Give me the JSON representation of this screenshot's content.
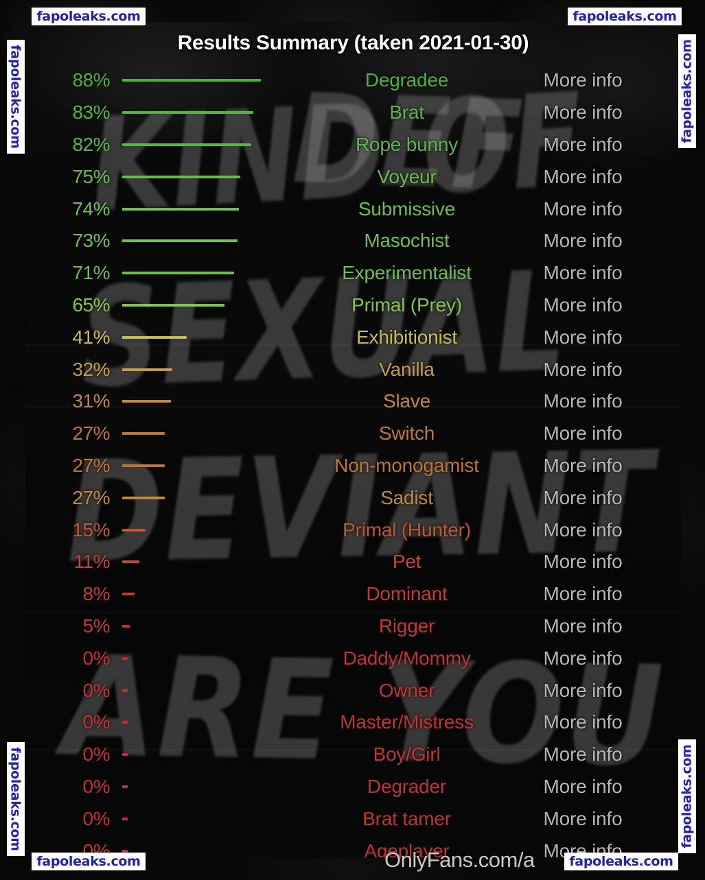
{
  "title": "Results Summary (taken 2021-01-30)",
  "handle": "OnlyFans.com/a",
  "more_info_label": "More info",
  "watermark": {
    "text": "fapoleaks.com",
    "color": "#2222aa"
  },
  "graffiti": [
    "KIND OF",
    "DEF",
    "SEXUAL",
    "DEVIANT",
    "ARE YOU"
  ],
  "colors": {
    "green": "#5bbf4b",
    "yellow": "#c9b23d",
    "orange": "#c2752f",
    "red": "#c73b32",
    "more_info": "#b5b5b5",
    "title": "#ffffff",
    "panel_bg": "#0a0a0a"
  },
  "chart_data": {
    "type": "bar",
    "title": "Results Summary (taken 2021-01-30)",
    "xlabel": "",
    "ylabel": "",
    "xlim": [
      0,
      100
    ],
    "grid": false,
    "legend": false,
    "orientation": "horizontal",
    "unit": "%",
    "categories": [
      "Degradee",
      "Brat",
      "Rope bunny",
      "Voyeur",
      "Submissive",
      "Masochist",
      "Experimentalist",
      "Primal (Prey)",
      "Exhibitionist",
      "Vanilla",
      "Slave",
      "Switch",
      "Non-monogamist",
      "Sadist",
      "Primal (Hunter)",
      "Pet",
      "Dominant",
      "Rigger",
      "Daddy/Mommy",
      "Owner",
      "Master/Mistress",
      "Boy/Girl",
      "Degrader",
      "Brat tamer",
      "Ageplayer"
    ],
    "values": [
      88,
      83,
      82,
      75,
      74,
      73,
      71,
      65,
      41,
      32,
      31,
      27,
      27,
      27,
      15,
      11,
      8,
      5,
      0,
      0,
      0,
      0,
      0,
      0,
      0
    ]
  },
  "rows": [
    {
      "pct": "88%",
      "value": 88,
      "label": "Degradee",
      "color": "#4caf3f",
      "more": "More info"
    },
    {
      "pct": "83%",
      "value": 83,
      "label": "Brat",
      "color": "#55b445",
      "more": "More info"
    },
    {
      "pct": "82%",
      "value": 82,
      "label": "Rope bunny",
      "color": "#57b646",
      "more": "More info"
    },
    {
      "pct": "75%",
      "value": 75,
      "label": "Voyeur",
      "color": "#66bd4e",
      "more": "More info"
    },
    {
      "pct": "74%",
      "value": 74,
      "label": "Submissive",
      "color": "#6dbf52",
      "more": "More info"
    },
    {
      "pct": "73%",
      "value": 73,
      "label": "Masochist",
      "color": "#6fc053",
      "more": "More info"
    },
    {
      "pct": "71%",
      "value": 71,
      "label": "Experimentalist",
      "color": "#6dbf52",
      "more": "More info"
    },
    {
      "pct": "65%",
      "value": 65,
      "label": "Primal (Prey)",
      "color": "#80c748",
      "more": "More info"
    },
    {
      "pct": "41%",
      "value": 41,
      "label": "Exhibitionist",
      "color": "#c6bb4e",
      "more": "More info"
    },
    {
      "pct": "32%",
      "value": 32,
      "label": "Vanilla",
      "color": "#c79a43",
      "more": "More info"
    },
    {
      "pct": "31%",
      "value": 31,
      "label": "Slave",
      "color": "#c4863a",
      "more": "More info"
    },
    {
      "pct": "27%",
      "value": 27,
      "label": "Switch",
      "color": "#c07536",
      "more": "More info"
    },
    {
      "pct": "27%",
      "value": 27,
      "label": "Non-monogamist",
      "color": "#c0752f",
      "more": "More info"
    },
    {
      "pct": "27%",
      "value": 27,
      "label": "Sadist",
      "color": "#c08a3a",
      "more": "More info"
    },
    {
      "pct": "15%",
      "value": 15,
      "label": "Primal (Hunter)",
      "color": "#c0562f",
      "more": "More info"
    },
    {
      "pct": "11%",
      "value": 11,
      "label": "Pet",
      "color": "#c24630",
      "more": "More info"
    },
    {
      "pct": "8%",
      "value": 8,
      "label": "Dominant",
      "color": "#c23d2e",
      "more": "More info"
    },
    {
      "pct": "5%",
      "value": 5,
      "label": "Rigger",
      "color": "#c4382e",
      "more": "More info"
    },
    {
      "pct": "0%",
      "value": 0,
      "label": "Daddy/Mommy",
      "color": "#c3322c",
      "more": "More info"
    },
    {
      "pct": "0%",
      "value": 0,
      "label": "Owner",
      "color": "#c3322c",
      "more": "More info"
    },
    {
      "pct": "0%",
      "value": 0,
      "label": "Master/Mistress",
      "color": "#c3322c",
      "more": "More info"
    },
    {
      "pct": "0%",
      "value": 0,
      "label": "Boy/Girl",
      "color": "#c3322c",
      "more": "More info"
    },
    {
      "pct": "0%",
      "value": 0,
      "label": "Degrader",
      "color": "#c3322c",
      "more": "More info"
    },
    {
      "pct": "0%",
      "value": 0,
      "label": "Brat tamer",
      "color": "#c3322c",
      "more": "More info"
    },
    {
      "pct": "0%",
      "value": 0,
      "label": "Ageplayer",
      "color": "#c3322c",
      "more": "More info"
    }
  ]
}
